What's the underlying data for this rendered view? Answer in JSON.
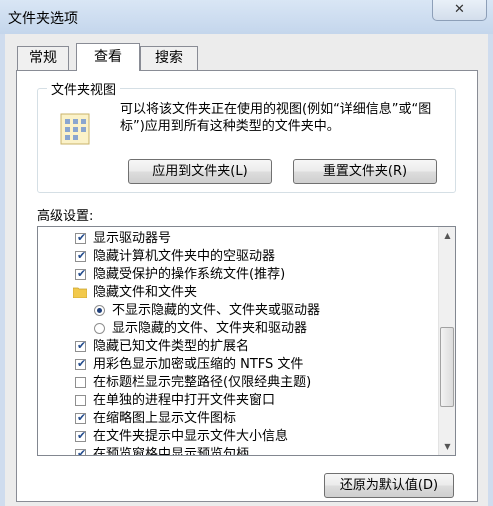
{
  "window": {
    "title": "文件夹选项",
    "close_glyph": "✕"
  },
  "tabs": [
    {
      "label": "常规",
      "active": false
    },
    {
      "label": "查看",
      "active": true
    },
    {
      "label": "搜索",
      "active": false
    }
  ],
  "folder_views": {
    "legend": "文件夹视图",
    "description": "可以将该文件夹正在使用的视图(例如“详细信息”或“图标”)应用到所有这种类型的文件夹中。",
    "apply_button": "应用到文件夹(L)",
    "reset_button": "重置文件夹(R)"
  },
  "advanced": {
    "label": "高级设置:",
    "items": [
      {
        "type": "checkbox",
        "checked": true,
        "label": "显示驱动器号"
      },
      {
        "type": "checkbox",
        "checked": true,
        "label": "隐藏计算机文件夹中的空驱动器"
      },
      {
        "type": "checkbox",
        "checked": true,
        "label": "隐藏受保护的操作系统文件(推荐)"
      },
      {
        "type": "folder",
        "label": "隐藏文件和文件夹"
      },
      {
        "type": "radio",
        "checked": true,
        "label": "不显示隐藏的文件、文件夹或驱动器"
      },
      {
        "type": "radio",
        "checked": false,
        "label": "显示隐藏的文件、文件夹和驱动器"
      },
      {
        "type": "checkbox",
        "checked": true,
        "label": "隐藏已知文件类型的扩展名"
      },
      {
        "type": "checkbox",
        "checked": true,
        "label": "用彩色显示加密或压缩的 NTFS 文件"
      },
      {
        "type": "checkbox",
        "checked": false,
        "label": "在标题栏显示完整路径(仅限经典主题)"
      },
      {
        "type": "checkbox",
        "checked": false,
        "label": "在单独的进程中打开文件夹窗口"
      },
      {
        "type": "checkbox",
        "checked": true,
        "label": "在缩略图上显示文件图标"
      },
      {
        "type": "checkbox",
        "checked": true,
        "label": "在文件夹提示中显示文件大小信息"
      },
      {
        "type": "checkbox",
        "checked": true,
        "label": "在预览窗格中显示预览句柄"
      }
    ]
  },
  "restore_defaults_button": "还原为默认值(D)",
  "icons": {
    "close": "close-icon",
    "folder_view": "folder-view-icon",
    "folder": "folder-icon",
    "scroll_up": "scroll-up-arrow-icon",
    "scroll_down": "scroll-down-arrow-icon"
  }
}
